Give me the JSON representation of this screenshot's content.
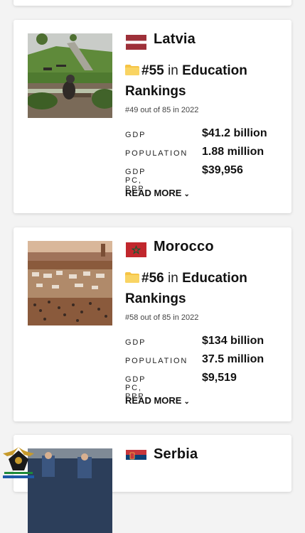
{
  "cards": [
    {
      "country": "Latvia",
      "rank": "#55",
      "rank_in": "in",
      "category_line1": "Education",
      "category_line2": "Rankings",
      "previous": "#49 out of 85 in 2022",
      "stats": [
        {
          "label": "GDP",
          "value": "$41.2 billion"
        },
        {
          "label": "POPULATION",
          "value": "1.88 million"
        },
        {
          "label": "GDP PC, PPP",
          "value": "$39,956"
        }
      ],
      "read_more": "READ MORE"
    },
    {
      "country": "Morocco",
      "rank": "#56",
      "rank_in": "in",
      "category_line1": "Education",
      "category_line2": "Rankings",
      "previous": "#58 out of 85 in 2022",
      "stats": [
        {
          "label": "GDP",
          "value": "$134 billion"
        },
        {
          "label": "POPULATION",
          "value": "37.5 million"
        },
        {
          "label": "GDP PC, PPP",
          "value": "$9,519"
        }
      ],
      "read_more": "READ MORE"
    },
    {
      "country": "Serbia"
    }
  ],
  "colors": {
    "latvia_red": "#9e3039",
    "morocco_red": "#c1272d",
    "morocco_green": "#006233",
    "serbia_red": "#c6363c",
    "serbia_blue": "#0c4076",
    "folder": "#f6c445"
  },
  "icons": [
    "folder-icon",
    "chevron-down-icon",
    "flag-latvia-icon",
    "flag-morocco-icon",
    "flag-serbia-icon"
  ]
}
